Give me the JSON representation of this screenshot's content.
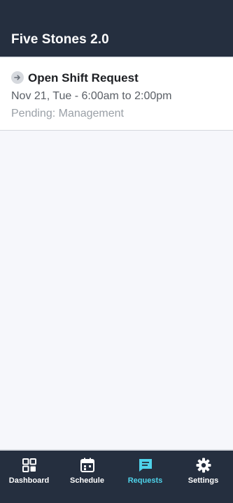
{
  "header": {
    "title": "Five Stones 2.0"
  },
  "requests": [
    {
      "icon": "arrow-right-circle-icon",
      "title": "Open Shift Request",
      "datetime": "Nov 21, Tue - 6:00am to 2:00pm",
      "status": "Pending: Management"
    }
  ],
  "tabbar": {
    "active": "requests",
    "accent_color": "#4fd3ea",
    "items": [
      {
        "id": "dashboard",
        "label": "Dashboard",
        "icon": "grid-icon"
      },
      {
        "id": "schedule",
        "label": "Schedule",
        "icon": "calendar-icon"
      },
      {
        "id": "requests",
        "label": "Requests",
        "icon": "chat-icon"
      },
      {
        "id": "settings",
        "label": "Settings",
        "icon": "gear-icon"
      }
    ]
  },
  "colors": {
    "header_bg": "#252f3f",
    "body_bg": "#f6f7fb"
  }
}
